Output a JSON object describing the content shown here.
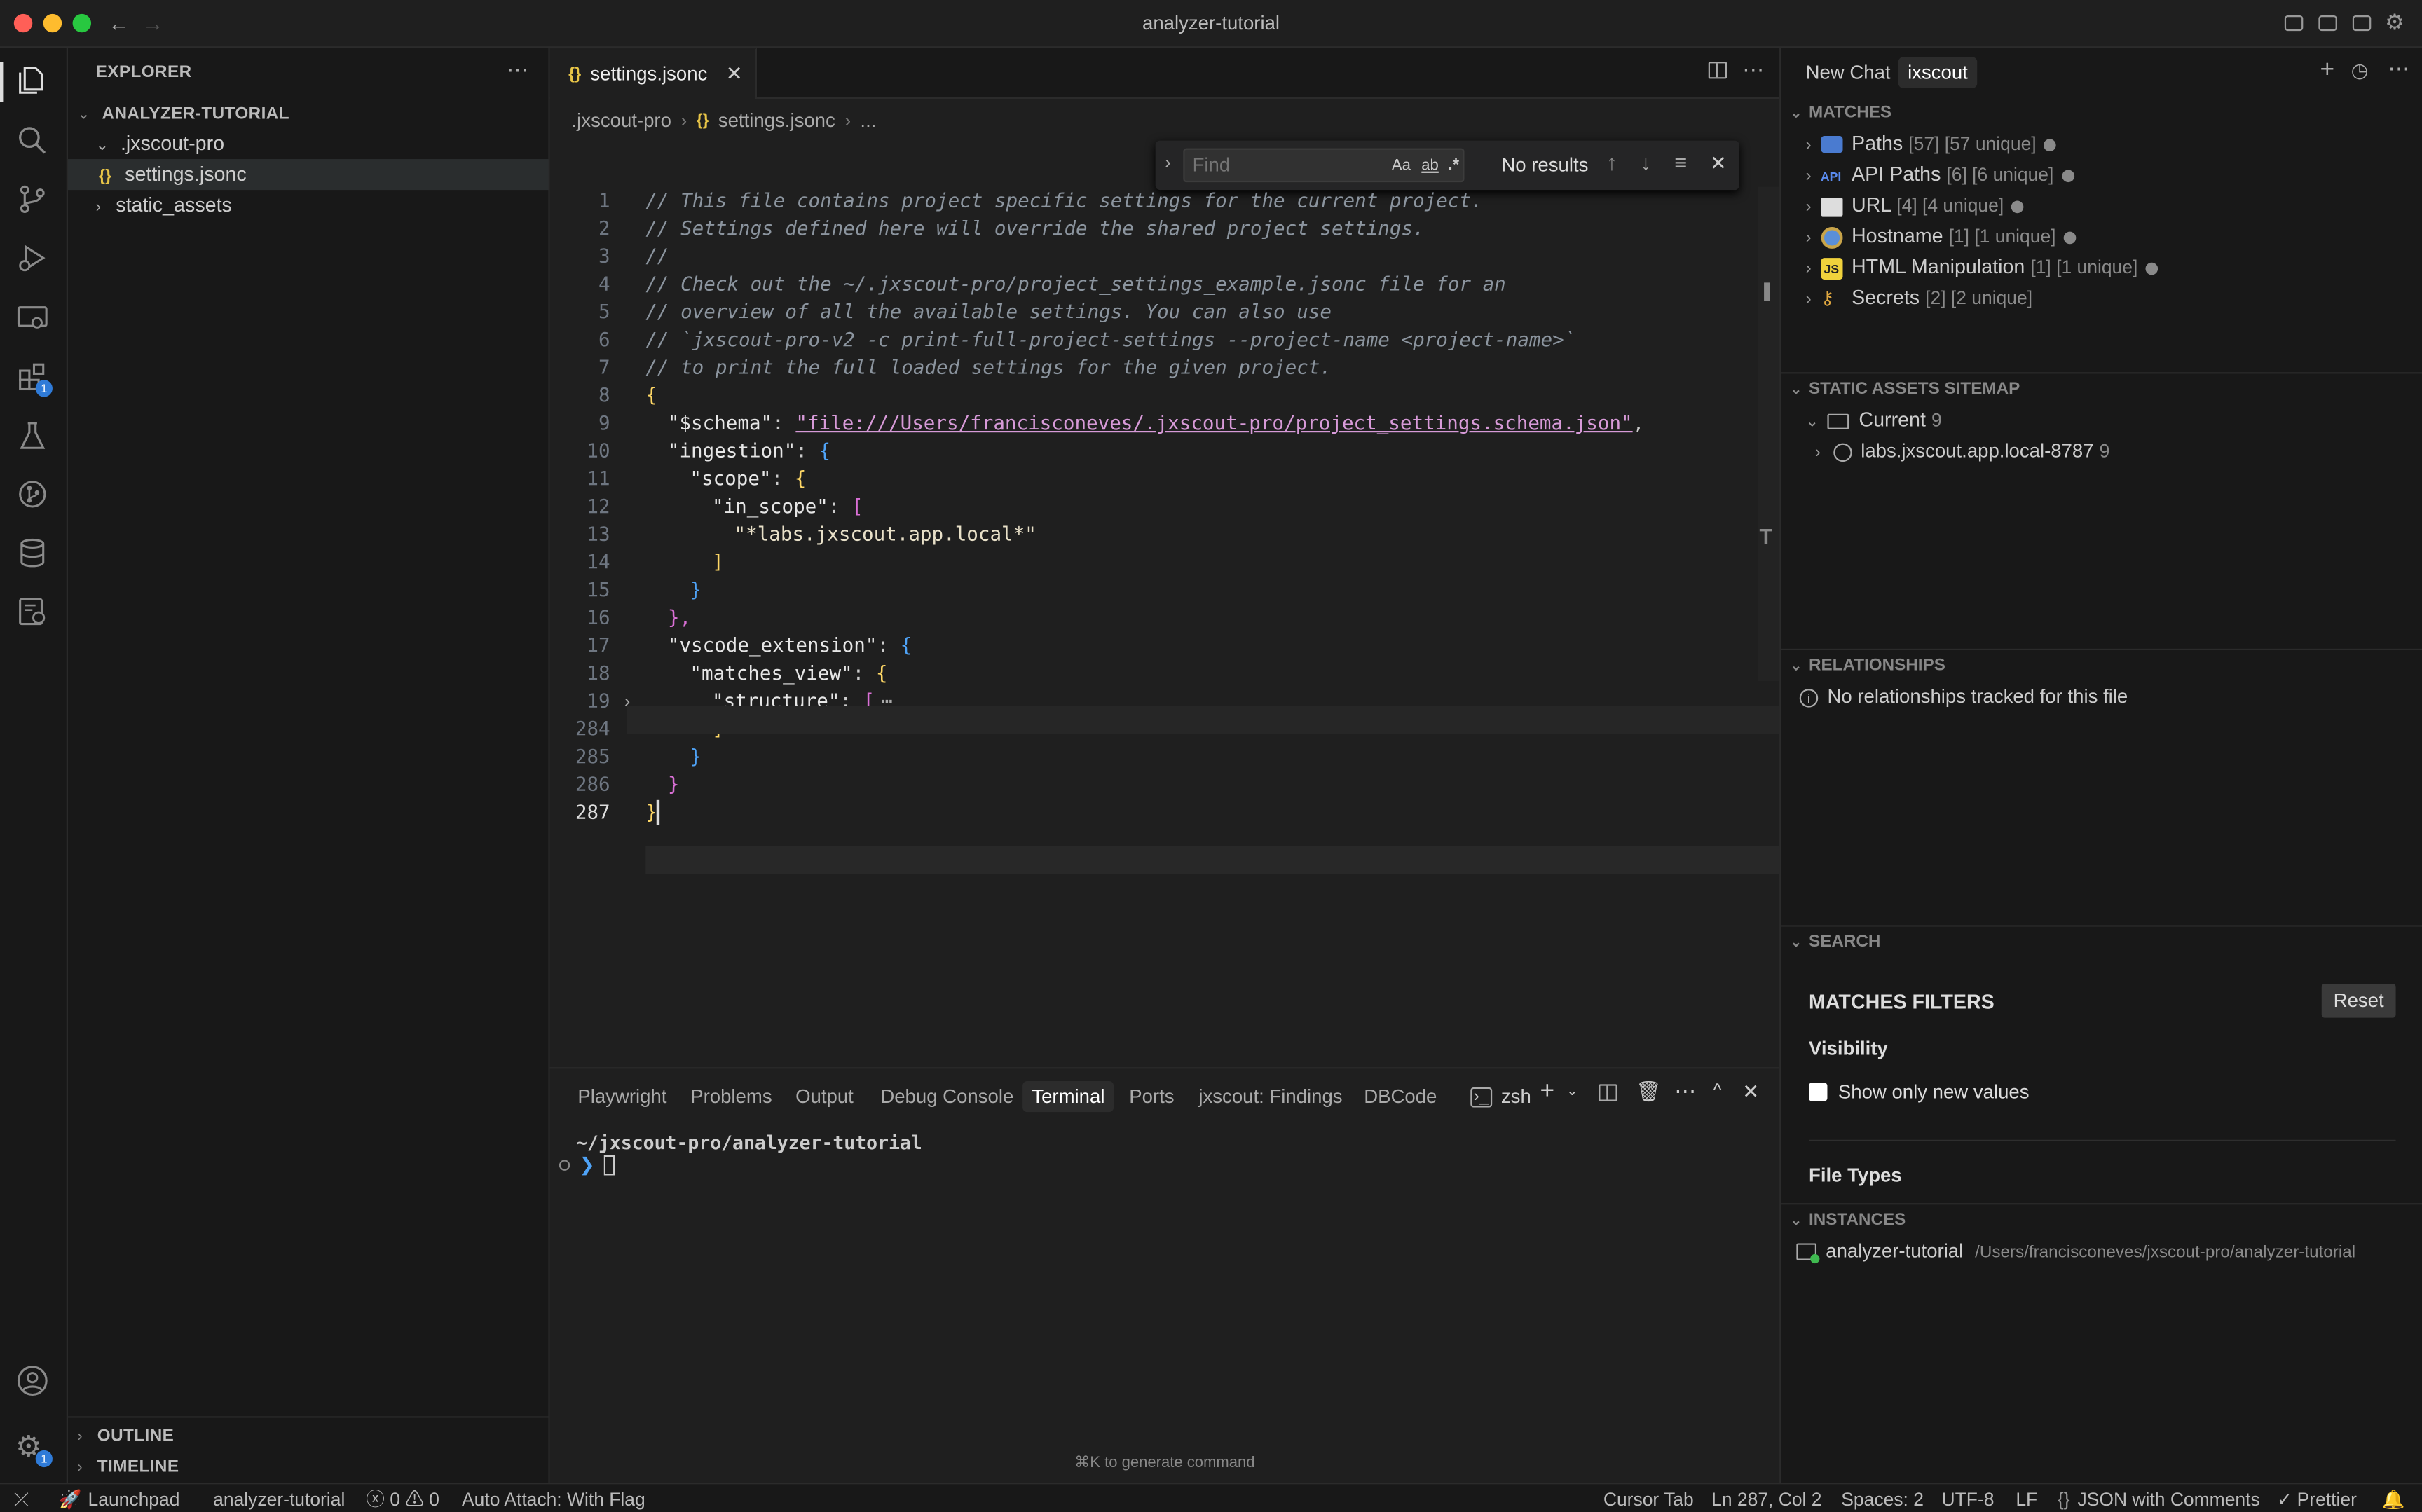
{
  "window": {
    "title": "analyzer-tutorial"
  },
  "activity": {
    "extensions_badge": "1",
    "account_badge": "1"
  },
  "explorer": {
    "title": "EXPLORER",
    "root": "ANALYZER-TUTORIAL",
    "items": [
      {
        "label": ".jxscout-pro"
      },
      {
        "label": "settings.jsonc"
      },
      {
        "label": "static_assets"
      }
    ],
    "outline": "OUTLINE",
    "timeline": "TIMELINE"
  },
  "editor": {
    "tab": {
      "icon": "{}",
      "label": "settings.jsonc"
    },
    "breadcrumb": {
      "folder": ".jxscout-pro",
      "file_icon": "{}",
      "file": "settings.jsonc",
      "more": "..."
    },
    "find": {
      "placeholder": "Find",
      "case": "Aa",
      "word": "ab",
      "regex": ".*",
      "results": "No results"
    },
    "lines": [
      {
        "n": "1",
        "text": "// This file contains project specific settings for the current project."
      },
      {
        "n": "2",
        "text": "// Settings defined here will override the shared project settings."
      },
      {
        "n": "3",
        "text": "//"
      },
      {
        "n": "4",
        "text": "// Check out the ~/.jxscout-pro/project_settings_example.jsonc file for an"
      },
      {
        "n": "5",
        "text": "// overview of all the available settings. You can also use"
      },
      {
        "n": "6",
        "text": "// `jxscout-pro-v2 -c print-full-project-settings --project-name <project-name>`"
      },
      {
        "n": "7",
        "text": "// to print the full loaded settings for the given project."
      },
      {
        "n": "8",
        "text": "{"
      },
      {
        "n": "9",
        "key": "\"$schema\"",
        "value": "\"file:///Users/francisconeves/.jxscout-pro/project_settings.schema.json\""
      },
      {
        "n": "10",
        "key": "\"ingestion\"",
        "open": "{"
      },
      {
        "n": "11",
        "key": "\"scope\"",
        "open": "{"
      },
      {
        "n": "12",
        "key": "\"in_scope\"",
        "open": "["
      },
      {
        "n": "13",
        "text": "\"*labs.jxscout.app.local*\""
      },
      {
        "n": "14",
        "text": "]"
      },
      {
        "n": "15",
        "text": "}"
      },
      {
        "n": "16",
        "text": "},"
      },
      {
        "n": "17",
        "key": "\"vscode_extension\"",
        "open": "{"
      },
      {
        "n": "18",
        "key": "\"matches_view\"",
        "open": "{"
      },
      {
        "n": "19",
        "key": "\"structure\"",
        "open": "[",
        "fold": "⋯"
      },
      {
        "n": "284",
        "text": "]"
      },
      {
        "n": "285",
        "text": "}"
      },
      {
        "n": "286",
        "text": "}"
      },
      {
        "n": "287",
        "text": "}"
      }
    ]
  },
  "panel": {
    "tabs": [
      "Playwright",
      "Problems",
      "Output",
      "Debug Console",
      "Terminal",
      "Ports",
      "jxscout: Findings",
      "DBCode"
    ],
    "active": "Terminal",
    "shell": "zsh",
    "cwd": "~/jxscout-pro/analyzer-tutorial",
    "prompt": "❯",
    "hint": "⌘K to generate command"
  },
  "right": {
    "chat_tabs": [
      "New Chat",
      "ixscout"
    ],
    "matches": {
      "title": "MATCHES",
      "items": [
        {
          "label": "Paths",
          "count": "[57] [57 unique]"
        },
        {
          "label": "API Paths",
          "count": "[6] [6 unique]"
        },
        {
          "label": "URL",
          "count": "[4] [4 unique]"
        },
        {
          "label": "Hostname",
          "count": "[1] [1 unique]"
        },
        {
          "label": "HTML Manipulation",
          "count": "[1] [1 unique]"
        },
        {
          "label": "Secrets",
          "count": "[2] [2 unique]"
        }
      ]
    },
    "sitemap": {
      "title": "STATIC ASSETS SITEMAP",
      "current": "Current",
      "current_count": "9",
      "host": "labs.jxscout.app.local-8787",
      "host_count": "9"
    },
    "relationships": {
      "title": "RELATIONSHIPS",
      "empty": "No relationships tracked for this file"
    },
    "search": {
      "title": "SEARCH",
      "filters_title": "MATCHES FILTERS",
      "reset": "Reset",
      "visibility": "Visibility",
      "show_new": "Show only new values",
      "file_types": "File Types"
    },
    "instances": {
      "title": "INSTANCES",
      "name": "analyzer-tutorial",
      "path": "/Users/francisconeves/jxscout-pro/analyzer-tutorial"
    }
  },
  "status": {
    "launchpad": "Launchpad",
    "project": "analyzer-tutorial",
    "errors": "0",
    "warnings": "0",
    "auto_attach": "Auto Attach: With Flag",
    "cursor_tab": "Cursor Tab",
    "position": "Ln 287, Col 2",
    "spaces": "Spaces: 2",
    "encoding": "UTF-8",
    "eol": "LF",
    "language": "JSON with Comments",
    "prettier": "Prettier"
  }
}
